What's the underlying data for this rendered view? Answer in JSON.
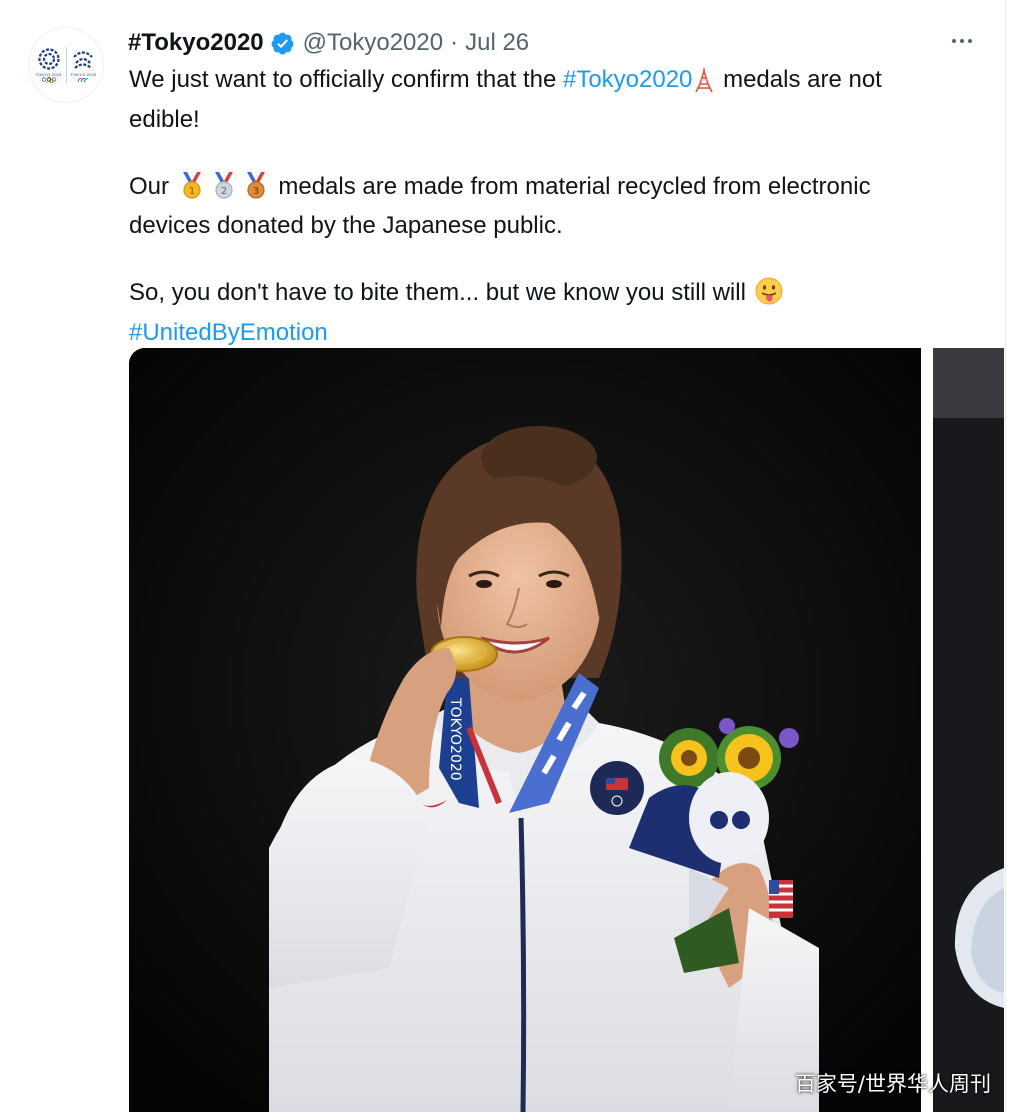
{
  "tweet": {
    "display_name": "#Tokyo2020",
    "handle": "@Tokyo2020",
    "separator": "·",
    "date": "Jul 26",
    "verified_icon": "verified-badge-icon",
    "more_icon": "more-options-icon",
    "avatar_icon": "tokyo2020-olympic-paralympic-emblems",
    "text": {
      "line1_before": "We just want to officially confirm that the ",
      "line1_hashtag": "#Tokyo2020",
      "line1_after": " medals are not",
      "line2": "edible!",
      "line3_before": "Our ",
      "line3_after": " medals are made from material recycled from electronic",
      "line4": "devices donated by the Japanese public.",
      "line5": "So, you don't have to bite them... but we know you still will ",
      "line6_hashtag": "#UnitedByEmotion"
    },
    "emojis": {
      "tower": "tokyo-tower-icon",
      "gold": "first-place-medal-icon",
      "silver": "second-place-medal-icon",
      "bronze": "third-place-medal-icon",
      "tongue": "face-with-tongue-icon"
    }
  },
  "media": {
    "main_photo": "athlete-biting-gold-medal-photo",
    "peek_photo": "second-photo-partial",
    "watermark": "百家号/世界华人周刊"
  },
  "colors": {
    "link": "#1d9bf0",
    "text": "#0f1419",
    "secondary": "#536471",
    "verified": "#1d9bf0"
  }
}
